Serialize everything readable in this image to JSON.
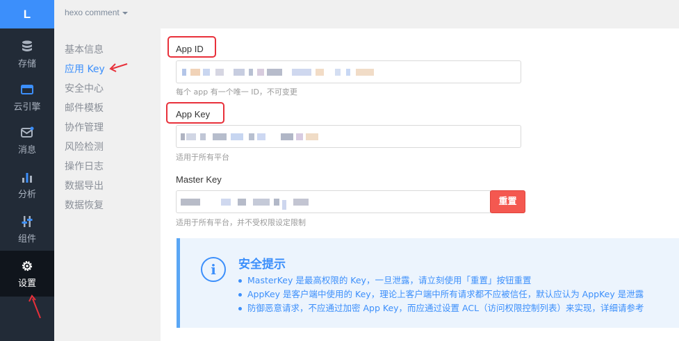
{
  "logo": "L",
  "app_selector": "hexo comment",
  "nav": [
    {
      "label": "存储",
      "icon": "database-icon"
    },
    {
      "label": "云引擎",
      "icon": "cloud-engine-icon"
    },
    {
      "label": "消息",
      "icon": "message-icon"
    },
    {
      "label": "分析",
      "icon": "bar-chart-icon"
    },
    {
      "label": "组件",
      "icon": "sliders-icon"
    },
    {
      "label": "设置",
      "icon": "gear-icon",
      "active": true
    }
  ],
  "submenu": [
    {
      "label": "基本信息"
    },
    {
      "label": "应用 Key",
      "active": true
    },
    {
      "label": "安全中心"
    },
    {
      "label": "邮件模板"
    },
    {
      "label": "协作管理"
    },
    {
      "label": "风险检测"
    },
    {
      "label": "操作日志"
    },
    {
      "label": "数据导出"
    },
    {
      "label": "数据恢复"
    }
  ],
  "fields": {
    "app_id": {
      "label": "App ID",
      "help": "每个 app 有一个唯一 ID，不可变更"
    },
    "app_key": {
      "label": "App Key",
      "help": "适用于所有平台"
    },
    "master_key": {
      "label": "Master Key",
      "help": "适用于所有平台，并不受权限设定限制",
      "reset_label": "重置"
    }
  },
  "tip": {
    "icon": "info-icon",
    "icon_glyph": "i",
    "title": "安全提示",
    "lines": [
      "MasterKey 是最高权限的 Key，一旦泄露，请立刻使用「重置」按钮重置",
      "AppKey 是客户端中使用的 Key，理论上客户端中所有请求都不应被信任，默认应认为 AppKey 是泄露",
      "防御恶意请求，不应通过加密 App Key，而应通过设置 ACL（访问权限控制列表）来实现，详细请参考"
    ]
  },
  "colors": {
    "accent": "#3c8ffb",
    "nav_bg": "#222b37",
    "danger": "#f45850",
    "highlight": "#e8303a"
  }
}
